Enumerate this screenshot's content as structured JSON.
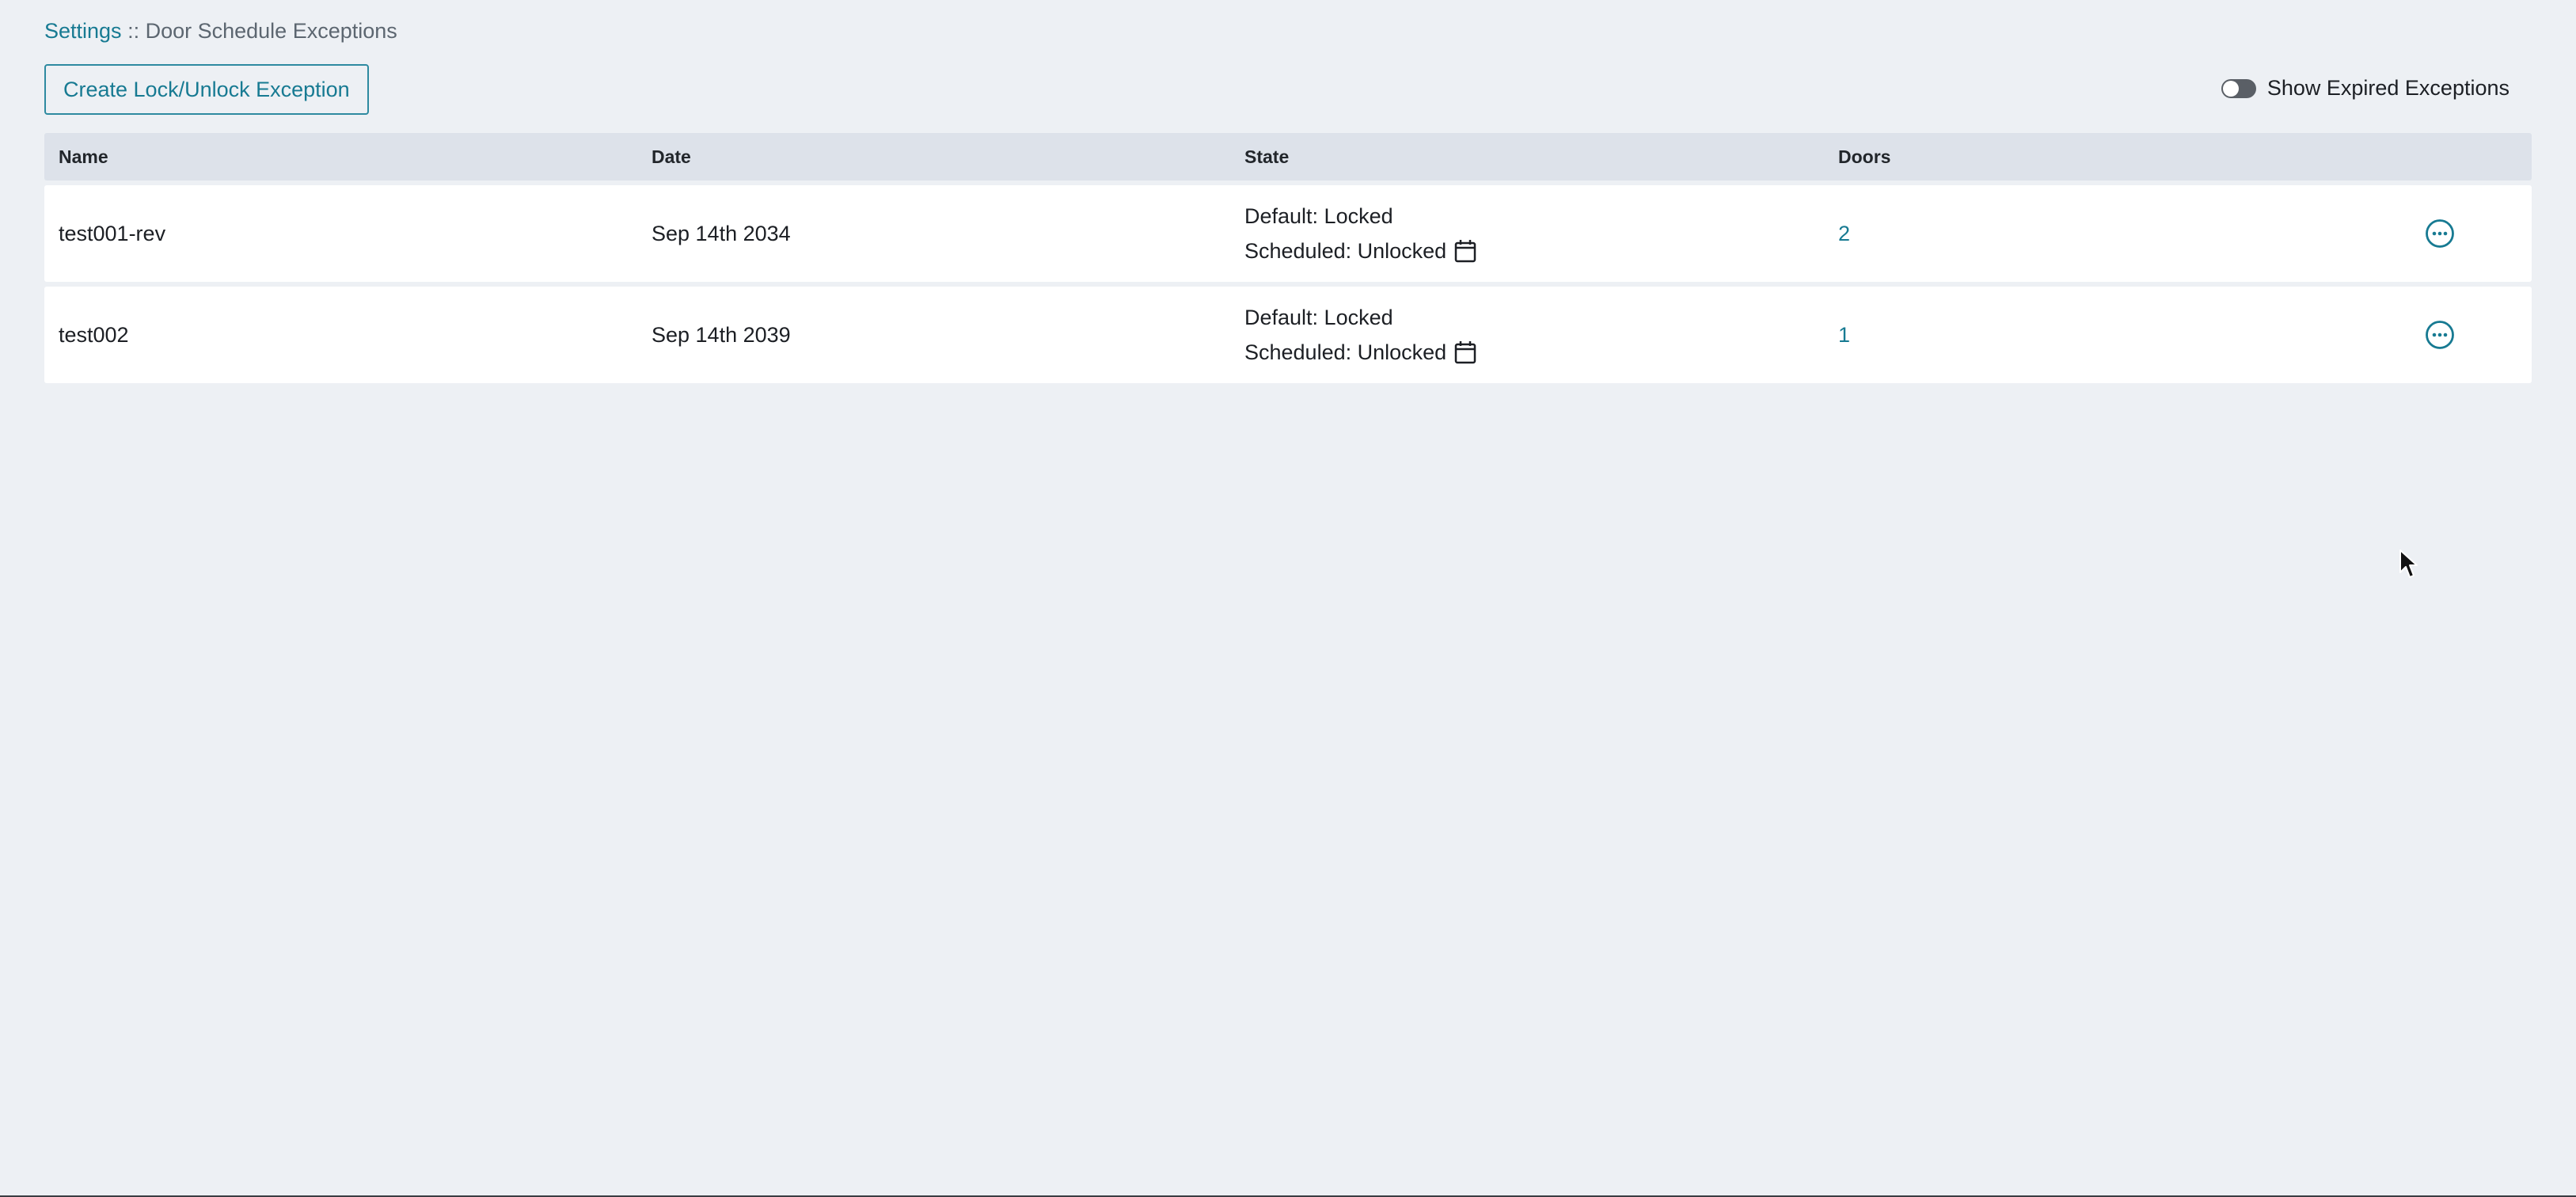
{
  "breadcrumb": {
    "root": "Settings",
    "separator": " :: ",
    "current": "Door Schedule Exceptions"
  },
  "toolbar": {
    "create_label": "Create Lock/Unlock Exception",
    "toggle_label": "Show Expired Exceptions",
    "toggle_on": false
  },
  "table": {
    "headers": [
      "Name",
      "Date",
      "State",
      "Doors"
    ],
    "rows": [
      {
        "name": "test001-rev",
        "date": "Sep 14th 2034",
        "state_default": "Default: Locked",
        "state_scheduled": "Scheduled: Unlocked",
        "doors": "2"
      },
      {
        "name": "test002",
        "date": "Sep 14th 2039",
        "state_default": "Default: Locked",
        "state_scheduled": "Scheduled: Unlocked",
        "doors": "1"
      }
    ]
  },
  "icons": {
    "calendar": "calendar-icon",
    "more": "more-options-icon",
    "cursor": "mouse-cursor-icon"
  },
  "colors": {
    "accent": "#177a92",
    "background": "#edf0f4",
    "header_bg": "#dde2ea",
    "row_bg": "#ffffff",
    "toggle_off": "#5a5f66"
  }
}
